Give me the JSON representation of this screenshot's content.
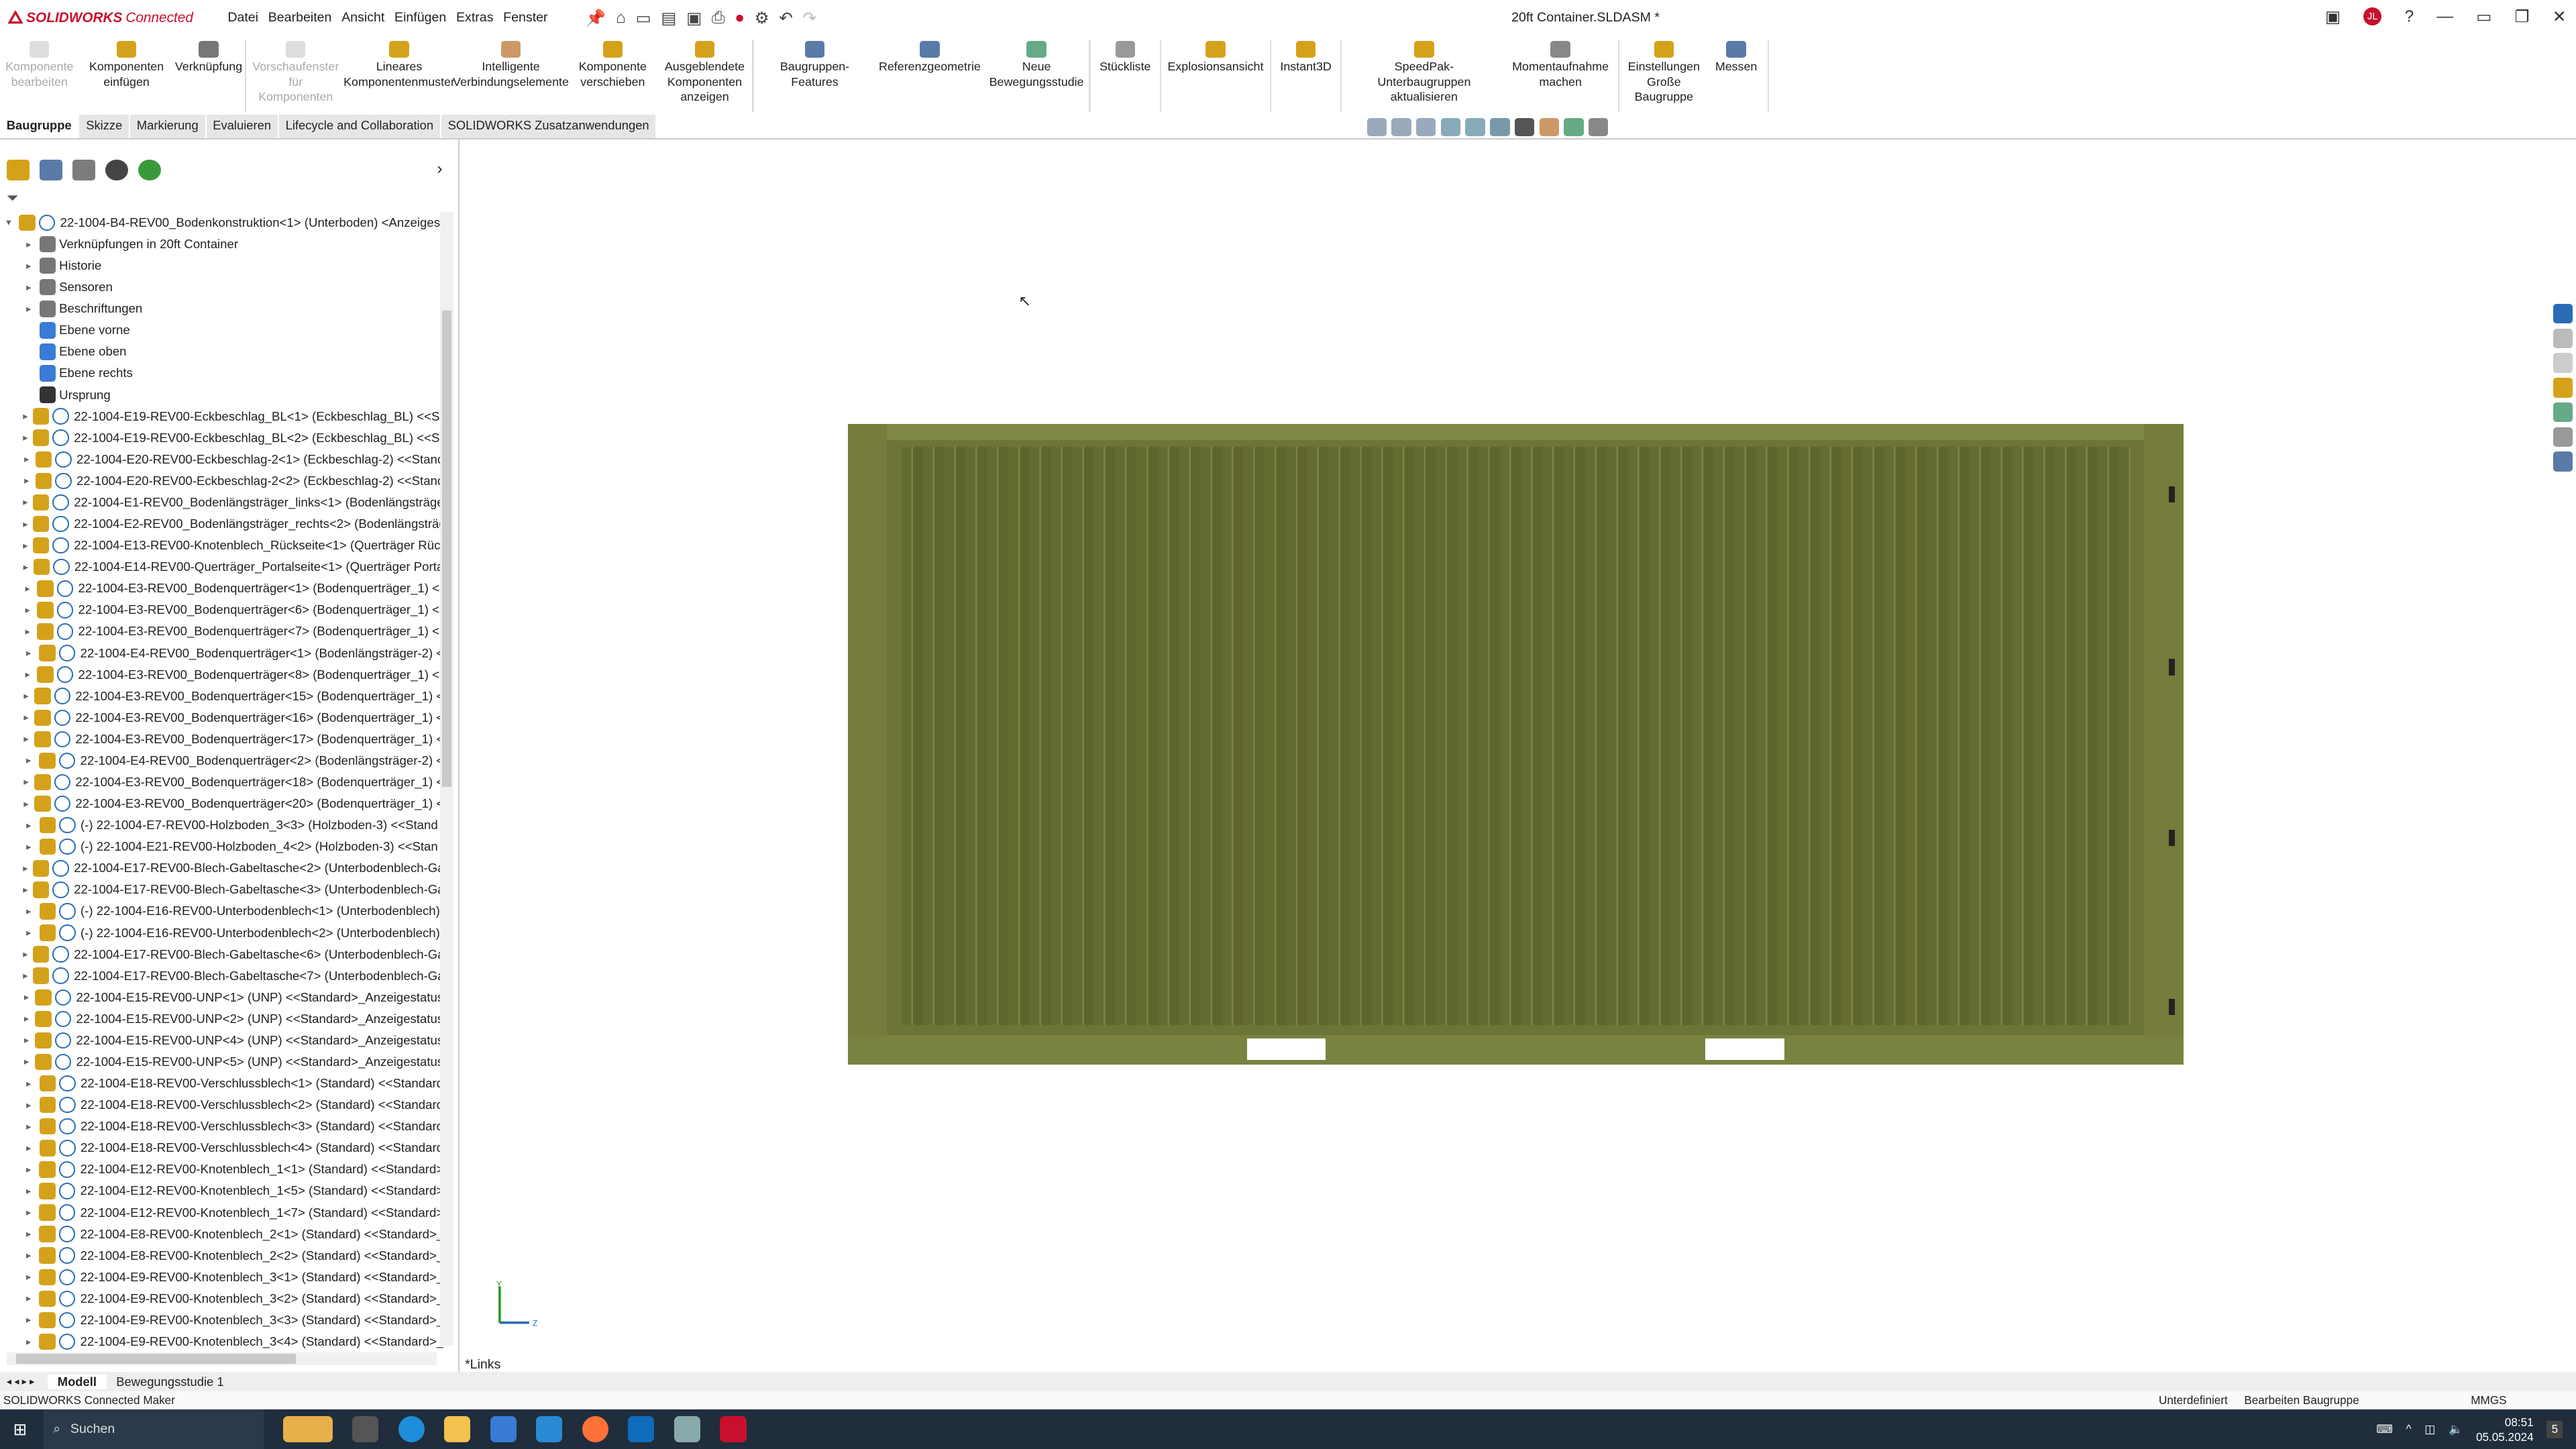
{
  "window": {
    "app_name": "SOLIDWORKS",
    "app_suffix": "Connected",
    "document_title": "20ft Container.SLDASM *",
    "menu": [
      "Datei",
      "Bearbeiten",
      "Ansicht",
      "Einfügen",
      "Extras",
      "Fenster"
    ]
  },
  "ribbon": [
    {
      "label": "Komponente bearbeiten",
      "disabled": true
    },
    {
      "label": "Komponenten einfügen",
      "disabled": false
    },
    {
      "label": "Verknüpfung",
      "disabled": false
    },
    {
      "label": "Vorschaufenster für Komponenten",
      "disabled": true
    },
    {
      "label": "Lineares Komponentenmuster",
      "disabled": false
    },
    {
      "label": "Intelligente Verbindungselemente",
      "disabled": false
    },
    {
      "label": "Komponente verschieben",
      "disabled": false
    },
    {
      "label": "Ausgeblendete Komponenten anzeigen",
      "disabled": false
    },
    {
      "label": "Baugruppen-Features",
      "disabled": false
    },
    {
      "label": "Referenzgeometrie",
      "disabled": false
    },
    {
      "label": "Neue Bewegungsstudie",
      "disabled": false
    },
    {
      "label": "Stückliste",
      "disabled": false
    },
    {
      "label": "Explosionsansicht",
      "disabled": false
    },
    {
      "label": "Instant3D",
      "disabled": false
    },
    {
      "label": "SpeedPak-Unterbaugruppen aktualisieren",
      "disabled": false
    },
    {
      "label": "Momentaufnahme machen",
      "disabled": false
    },
    {
      "label": "Einstellungen Große Baugruppe",
      "disabled": false
    },
    {
      "label": "Messen",
      "disabled": false
    }
  ],
  "cmd_tabs": [
    "Baugruppe",
    "Skizze",
    "Markierung",
    "Evaluieren",
    "Lifecycle and Collaboration",
    "SOLIDWORKS Zusatzanwendungen"
  ],
  "tree": [
    {
      "text": "22-1004-B4-REV00_Bodenkonstruktion<1> (Unterboden) <Anzeigest",
      "level": 0,
      "kind": "root"
    },
    {
      "text": "Verknüpfungen in 20ft Container",
      "level": 1,
      "kind": "folder"
    },
    {
      "text": "Historie",
      "level": 1,
      "kind": "folder"
    },
    {
      "text": "Sensoren",
      "level": 1,
      "kind": "folder"
    },
    {
      "text": "Beschriftungen",
      "level": 1,
      "kind": "folder"
    },
    {
      "text": "Ebene vorne",
      "level": 1,
      "kind": "plane"
    },
    {
      "text": "Ebene oben",
      "level": 1,
      "kind": "plane"
    },
    {
      "text": "Ebene rechts",
      "level": 1,
      "kind": "plane"
    },
    {
      "text": "Ursprung",
      "level": 1,
      "kind": "origin"
    },
    {
      "text": "22-1004-E19-REV00-Eckbeschlag_BL<1> (Eckbeschlag_BL) <<Sta",
      "level": 1,
      "kind": "part"
    },
    {
      "text": "22-1004-E19-REV00-Eckbeschlag_BL<2> (Eckbeschlag_BL) <<Sta",
      "level": 1,
      "kind": "part"
    },
    {
      "text": "22-1004-E20-REV00-Eckbeschlag-2<1> (Eckbeschlag-2) <<Stanc",
      "level": 1,
      "kind": "part"
    },
    {
      "text": "22-1004-E20-REV00-Eckbeschlag-2<2> (Eckbeschlag-2) <<Stanc",
      "level": 1,
      "kind": "part"
    },
    {
      "text": "22-1004-E1-REV00_Bodenlängsträger_links<1> (Bodenlängsträge",
      "level": 1,
      "kind": "part"
    },
    {
      "text": "22-1004-E2-REV00_Bodenlängsträger_rechts<2> (Bodenlängsträg",
      "level": 1,
      "kind": "part"
    },
    {
      "text": "22-1004-E13-REV00-Knotenblech_Rückseite<1> (Querträger Rück",
      "level": 1,
      "kind": "part"
    },
    {
      "text": "22-1004-E14-REV00-Querträger_Portalseite<1> (Querträger Porta",
      "level": 1,
      "kind": "part"
    },
    {
      "text": "22-1004-E3-REV00_Bodenquerträger<1> (Bodenquerträger_1) <-",
      "level": 1,
      "kind": "part"
    },
    {
      "text": "22-1004-E3-REV00_Bodenquerträger<6> (Bodenquerträger_1) <-",
      "level": 1,
      "kind": "part"
    },
    {
      "text": "22-1004-E3-REV00_Bodenquerträger<7> (Bodenquerträger_1) <-",
      "level": 1,
      "kind": "part"
    },
    {
      "text": "22-1004-E4-REV00_Bodenquerträger<1> (Bodenlängsträger-2) <",
      "level": 1,
      "kind": "part"
    },
    {
      "text": "22-1004-E3-REV00_Bodenquerträger<8> (Bodenquerträger_1) <-",
      "level": 1,
      "kind": "part"
    },
    {
      "text": "22-1004-E3-REV00_Bodenquerträger<15> (Bodenquerträger_1) <",
      "level": 1,
      "kind": "part"
    },
    {
      "text": "22-1004-E3-REV00_Bodenquerträger<16> (Bodenquerträger_1) <",
      "level": 1,
      "kind": "part"
    },
    {
      "text": "22-1004-E3-REV00_Bodenquerträger<17> (Bodenquerträger_1) <",
      "level": 1,
      "kind": "part"
    },
    {
      "text": "22-1004-E4-REV00_Bodenquerträger<2> (Bodenlängsträger-2) <",
      "level": 1,
      "kind": "part"
    },
    {
      "text": "22-1004-E3-REV00_Bodenquerträger<18> (Bodenquerträger_1) <",
      "level": 1,
      "kind": "part"
    },
    {
      "text": "22-1004-E3-REV00_Bodenquerträger<20> (Bodenquerträger_1) <",
      "level": 1,
      "kind": "part"
    },
    {
      "text": "(-) 22-1004-E7-REV00-Holzboden_3<3> (Holzboden-3) <<Stand",
      "level": 1,
      "kind": "part"
    },
    {
      "text": "(-) 22-1004-E21-REV00-Holzboden_4<2> (Holzboden-3) <<Stan",
      "level": 1,
      "kind": "part"
    },
    {
      "text": "22-1004-E17-REV00-Blech-Gabeltasche<2> (Unterbodenblech-Ga",
      "level": 1,
      "kind": "part"
    },
    {
      "text": "22-1004-E17-REV00-Blech-Gabeltasche<3> (Unterbodenblech-Ga",
      "level": 1,
      "kind": "part"
    },
    {
      "text": "(-) 22-1004-E16-REV00-Unterbodenblech<1> (Unterbodenblech)",
      "level": 1,
      "kind": "part"
    },
    {
      "text": "(-) 22-1004-E16-REV00-Unterbodenblech<2> (Unterbodenblech)",
      "level": 1,
      "kind": "part"
    },
    {
      "text": "22-1004-E17-REV00-Blech-Gabeltasche<6> (Unterbodenblech-Ga",
      "level": 1,
      "kind": "part"
    },
    {
      "text": "22-1004-E17-REV00-Blech-Gabeltasche<7> (Unterbodenblech-Ga",
      "level": 1,
      "kind": "part"
    },
    {
      "text": "22-1004-E15-REV00-UNP<1> (UNP) <<Standard>_Anzeigestatus",
      "level": 1,
      "kind": "part"
    },
    {
      "text": "22-1004-E15-REV00-UNP<2> (UNP) <<Standard>_Anzeigestatus",
      "level": 1,
      "kind": "part"
    },
    {
      "text": "22-1004-E15-REV00-UNP<4> (UNP) <<Standard>_Anzeigestatus",
      "level": 1,
      "kind": "part"
    },
    {
      "text": "22-1004-E15-REV00-UNP<5> (UNP) <<Standard>_Anzeigestatus",
      "level": 1,
      "kind": "part"
    },
    {
      "text": "22-1004-E18-REV00-Verschlussblech<1> (Standard) <<Standard",
      "level": 1,
      "kind": "part"
    },
    {
      "text": "22-1004-E18-REV00-Verschlussblech<2> (Standard) <<Standard",
      "level": 1,
      "kind": "part"
    },
    {
      "text": "22-1004-E18-REV00-Verschlussblech<3> (Standard) <<Standard",
      "level": 1,
      "kind": "part"
    },
    {
      "text": "22-1004-E18-REV00-Verschlussblech<4> (Standard) <<Standard",
      "level": 1,
      "kind": "part"
    },
    {
      "text": "22-1004-E12-REV00-Knotenblech_1<1> (Standard) <<Standard>",
      "level": 1,
      "kind": "part"
    },
    {
      "text": "22-1004-E12-REV00-Knotenblech_1<5> (Standard) <<Standard>",
      "level": 1,
      "kind": "part"
    },
    {
      "text": "22-1004-E12-REV00-Knotenblech_1<7> (Standard) <<Standard>",
      "level": 1,
      "kind": "part"
    },
    {
      "text": "22-1004-E8-REV00-Knotenblech_2<1> (Standard) <<Standard>_",
      "level": 1,
      "kind": "part"
    },
    {
      "text": "22-1004-E8-REV00-Knotenblech_2<2> (Standard) <<Standard>_",
      "level": 1,
      "kind": "part"
    },
    {
      "text": "22-1004-E9-REV00-Knotenblech_3<1> (Standard) <<Standard>_",
      "level": 1,
      "kind": "part"
    },
    {
      "text": "22-1004-E9-REV00-Knotenblech_3<2> (Standard) <<Standard>_",
      "level": 1,
      "kind": "part"
    },
    {
      "text": "22-1004-E9-REV00-Knotenblech_3<3> (Standard) <<Standard>_",
      "level": 1,
      "kind": "part"
    },
    {
      "text": "22-1004-E9-REV00-Knotenblech_3<4> (Standard) <<Standard>_",
      "level": 1,
      "kind": "part"
    }
  ],
  "viewport": {
    "view_label": "*Links",
    "axis_y": "Y",
    "axis_z": "Z"
  },
  "bottom_tabs": [
    "Modell",
    "Bewegungsstudie 1"
  ],
  "status": {
    "left": "SOLIDWORKS Connected Maker",
    "state": "Unterdefiniert",
    "mode": "Bearbeiten Baugruppe",
    "units": "MMGS"
  },
  "taskbar": {
    "search_placeholder": "Suchen",
    "time": "08:51",
    "date": "05.05.2024",
    "notif_count": "5"
  },
  "colors": {
    "container": "#6d7437",
    "brand": "#c8102e",
    "taskbar": "#1f2d3c"
  }
}
